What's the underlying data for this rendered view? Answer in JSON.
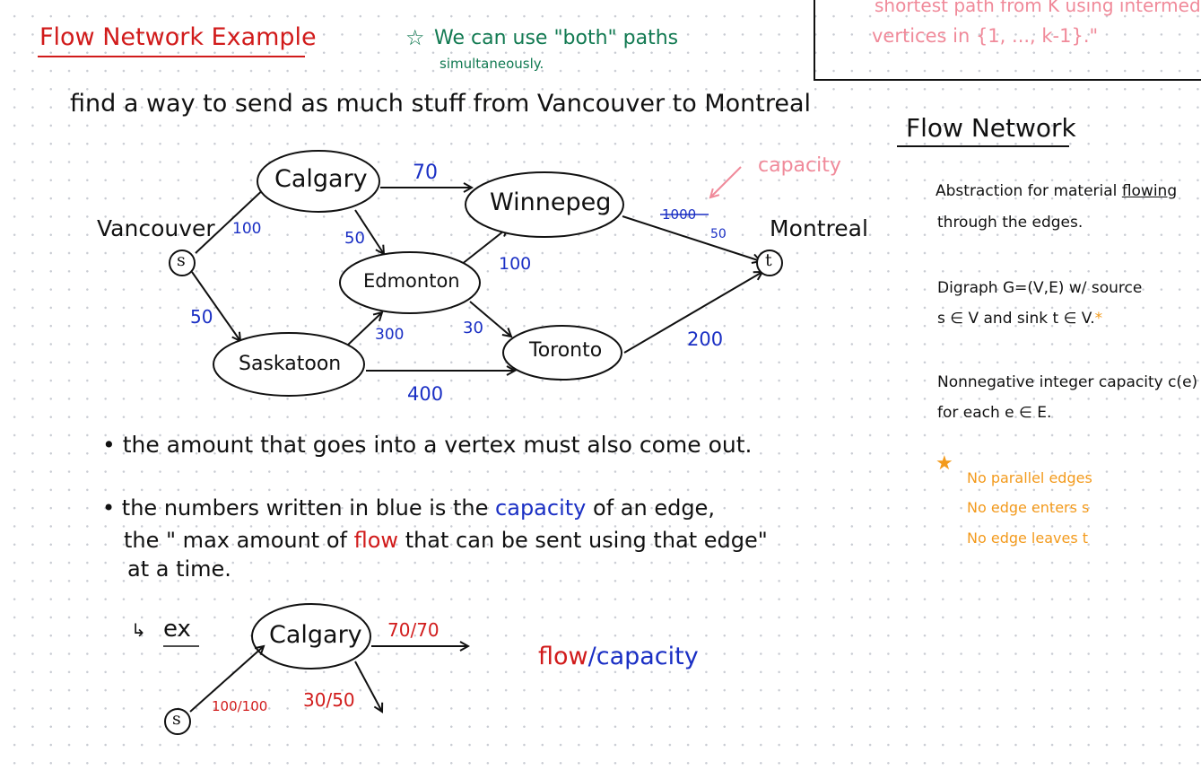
{
  "header": {
    "title": "Flow Network Example",
    "note_line1": "We can use \"both\" paths",
    "note_line2": "simultaneously."
  },
  "top_box": {
    "line1": "shortest path from K using intermediate",
    "line2": "vertices in {1, ..., k-1}.\""
  },
  "prompt": "find a way to send as much stuff from Vancouver to Montreal",
  "capacity_callout": "capacity",
  "colors": {
    "title_red": "#d11b1b",
    "note_green": "#127a52",
    "capacity_blue": "#1a2fc4",
    "callout_pink": "#f08a9a",
    "orange": "#f39a1c"
  },
  "graph": {
    "city_labels": {
      "vancouver": "Vancouver",
      "montreal": "Montreal"
    },
    "nodes": {
      "s": "s",
      "t": "t",
      "calgary": "Calgary",
      "winnepeg": "Winnepeg",
      "edmonton": "Edmonton",
      "saskatoon": "Saskatoon",
      "toronto": "Toronto"
    },
    "capacities": {
      "s_calgary": "100",
      "s_saskatoon": "50",
      "calgary_winnepeg": "70",
      "calgary_edmonton": "50",
      "edmonton_winnepeg": "100",
      "edmonton_toronto": "30",
      "saskatoon_edmonton": "300",
      "saskatoon_toronto": "400",
      "winnepeg_montreal_old": "1000",
      "winnepeg_montreal": "50",
      "toronto_montreal": "200"
    }
  },
  "bullets": {
    "b1": "the amount that goes into a vertex must also come out.",
    "b2_part1": "the numbers written in blue is the",
    "b2_capacity": "capacity",
    "b2_part2": "of an edge,",
    "b3_part1": "the \" max amount of",
    "b3_flow": "flow",
    "b3_part2": "that can be sent using that edge\"",
    "b4": "at a time."
  },
  "example": {
    "arrow_label": "↳",
    "ex_label": "ex",
    "node_s": "s",
    "node_calgary": "Calgary",
    "flow_s_calgary": "100/100",
    "flow_calgary_right": "70/70",
    "flow_calgary_down": "30/50",
    "legend_flow": "flow",
    "legend_slash": "/",
    "legend_capacity": "capacity"
  },
  "sidebar": {
    "heading": "Flow Network",
    "p1_line1": "Abstraction for material",
    "p1_flowing": "flowing",
    "p1_line2": "through the edges.",
    "p2_line1": "Digraph G=(V,E) w/ source",
    "p2_line2": "s ∈ V and sink t ∈ V.",
    "p2_star": "*",
    "p3_line1": "Nonnegative integer capacity c(e)",
    "p3_line2": "for each e ∈ E.",
    "notes_star": "★",
    "note1": "No parallel edges",
    "note2": "No edge enters s",
    "note3": "No edge leaves t"
  }
}
